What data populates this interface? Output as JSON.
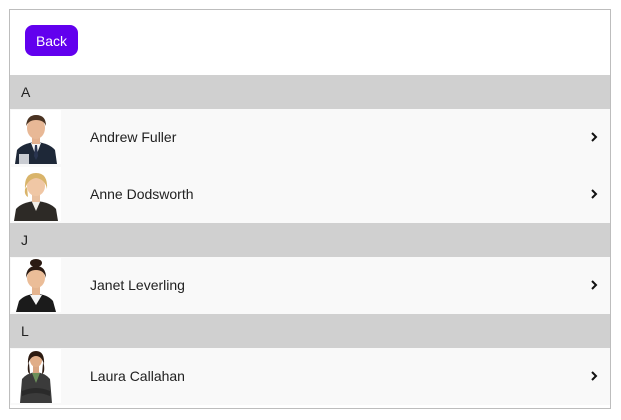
{
  "toolbar": {
    "back_label": "Back",
    "back_color": "#6200ee"
  },
  "groups": [
    {
      "letter": "A",
      "contacts": [
        {
          "name": "Andrew Fuller",
          "avatar_icon": "man-in-suit-avatar",
          "chevron_icon": "chevron-right-icon"
        },
        {
          "name": "Anne Dodsworth",
          "avatar_icon": "woman-blonde-avatar",
          "chevron_icon": "chevron-right-icon"
        }
      ]
    },
    {
      "letter": "J",
      "contacts": [
        {
          "name": "Janet Leverling",
          "avatar_icon": "woman-dark-hair-avatar",
          "chevron_icon": "chevron-right-icon"
        }
      ]
    },
    {
      "letter": "L",
      "contacts": [
        {
          "name": "Laura Callahan",
          "avatar_icon": "woman-arms-crossed-avatar",
          "chevron_icon": "chevron-right-icon"
        }
      ]
    }
  ],
  "colors": {
    "group_header_bg": "#d0d0d0",
    "row_bg": "#f9f9f9"
  }
}
